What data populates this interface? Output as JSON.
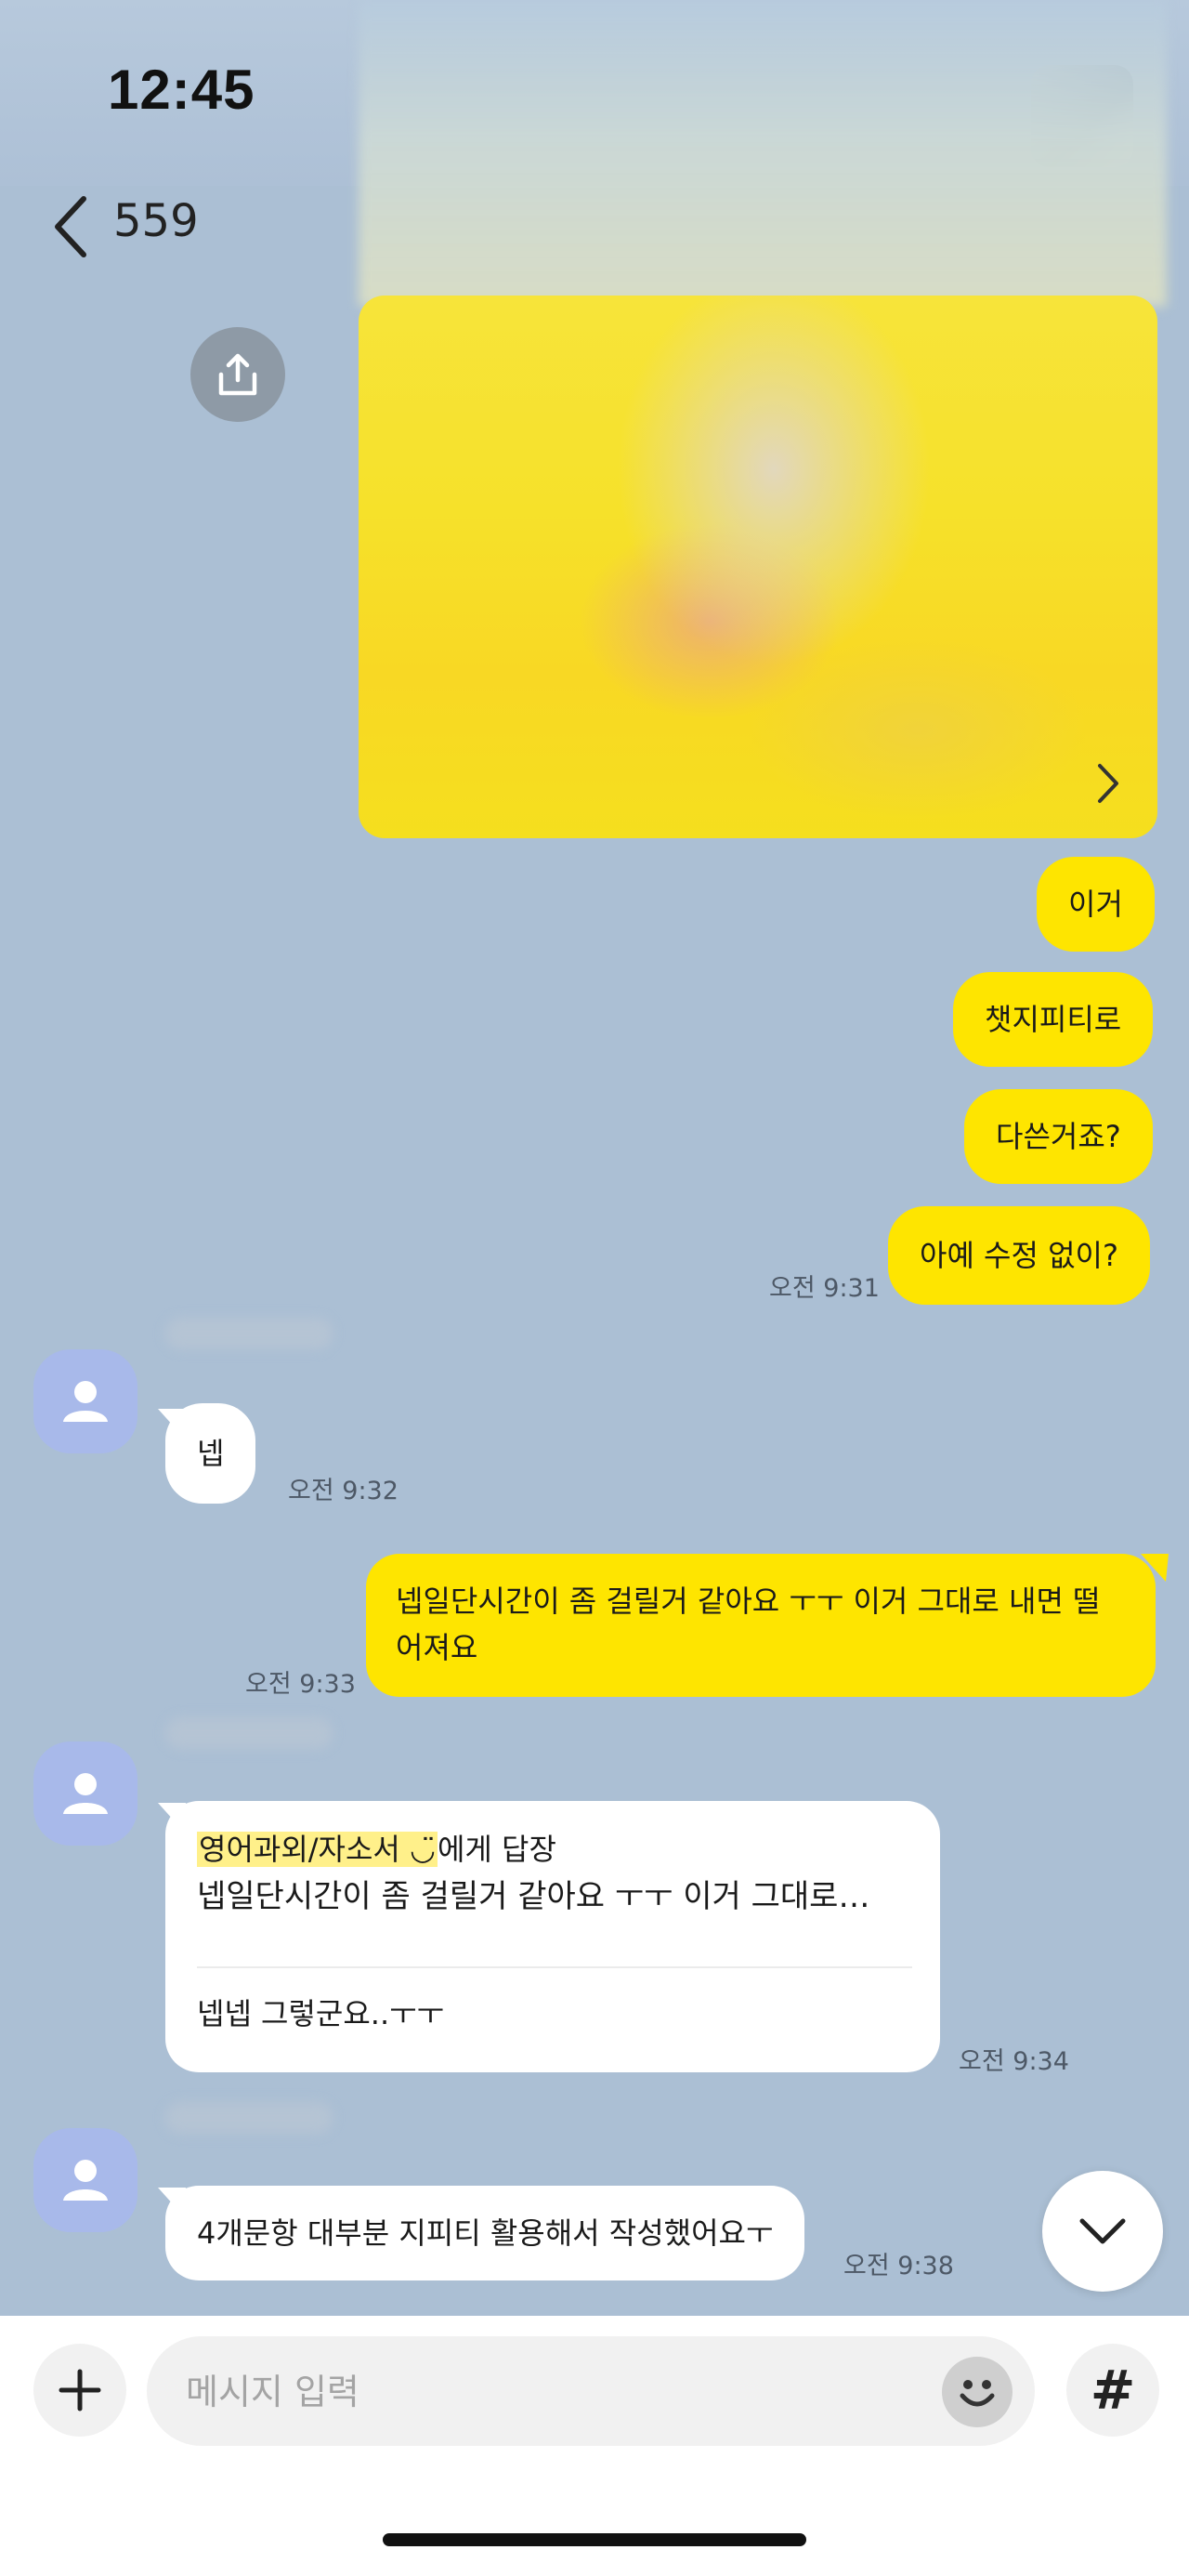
{
  "status_bar": {
    "time": "12:45"
  },
  "header": {
    "title": "559"
  },
  "messages": {
    "m1": "이거",
    "m2": "챗지피티로",
    "m3": "다쓴거죠?",
    "m4": "아예 수정 없이?",
    "t1": "오전 9:31",
    "m5": "넵",
    "t2": "오전 9:32",
    "m6_line1": "넵일단시간이 좀 걸릴거 같아요 ㅜㅜ 이거 그대로 내면 떨",
    "m6_line2": "어져요",
    "t3": "오전 9:33",
    "reply": {
      "to_name": "영어과외/자소서 ◡̈",
      "suffix": "에게 답장",
      "quote": "넵일단시간이 좀 걸릴거 같아요 ㅜㅜ 이거 그대로…",
      "body": "넵넵 그렇군요..ㅜㅜ"
    },
    "t4": "오전 9:34",
    "m7": "4개문항 대부분 지피티 활용해서 작성했어요ㅜ",
    "t5": "오전 9:38"
  },
  "composer": {
    "placeholder": "메시지 입력",
    "hash_label": "#"
  },
  "colors": {
    "my_bubble": "#fee500",
    "chat_bg": "#abbfd4",
    "avatar": "#a8b9ea"
  },
  "icons": [
    "back-chevron-icon",
    "share-icon",
    "chevron-right-icon",
    "person-icon",
    "chevron-down-icon",
    "plus-icon",
    "emoji-icon"
  ]
}
